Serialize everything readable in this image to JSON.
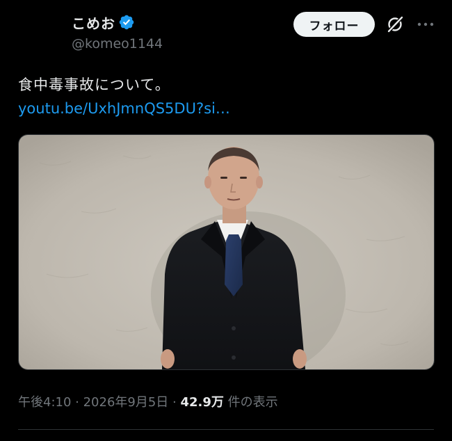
{
  "author": {
    "display_name": "こめお",
    "handle": "@komeo1144",
    "verified_icon": "verified-badge-icon",
    "verified_color": "#1d9bf0"
  },
  "actions": {
    "follow_label": "フォロー",
    "grok_icon": "grok-icon",
    "more_icon": "more-icon"
  },
  "tweet": {
    "text": "食中毒事故について。",
    "link": "youtu.be/UxhJmnQS5DU?si…",
    "link_color": "#1d9bf0"
  },
  "meta": {
    "time": "午後4:10",
    "sep1": " · ",
    "date": "2026年9月5日",
    "sep2": " · ",
    "views_count": "42.9万",
    "views_label": " 件の表示"
  },
  "colors": {
    "background": "#000000",
    "text": "#e7e9ea",
    "secondary": "#71767b",
    "follow_bg": "#eff3f4"
  }
}
